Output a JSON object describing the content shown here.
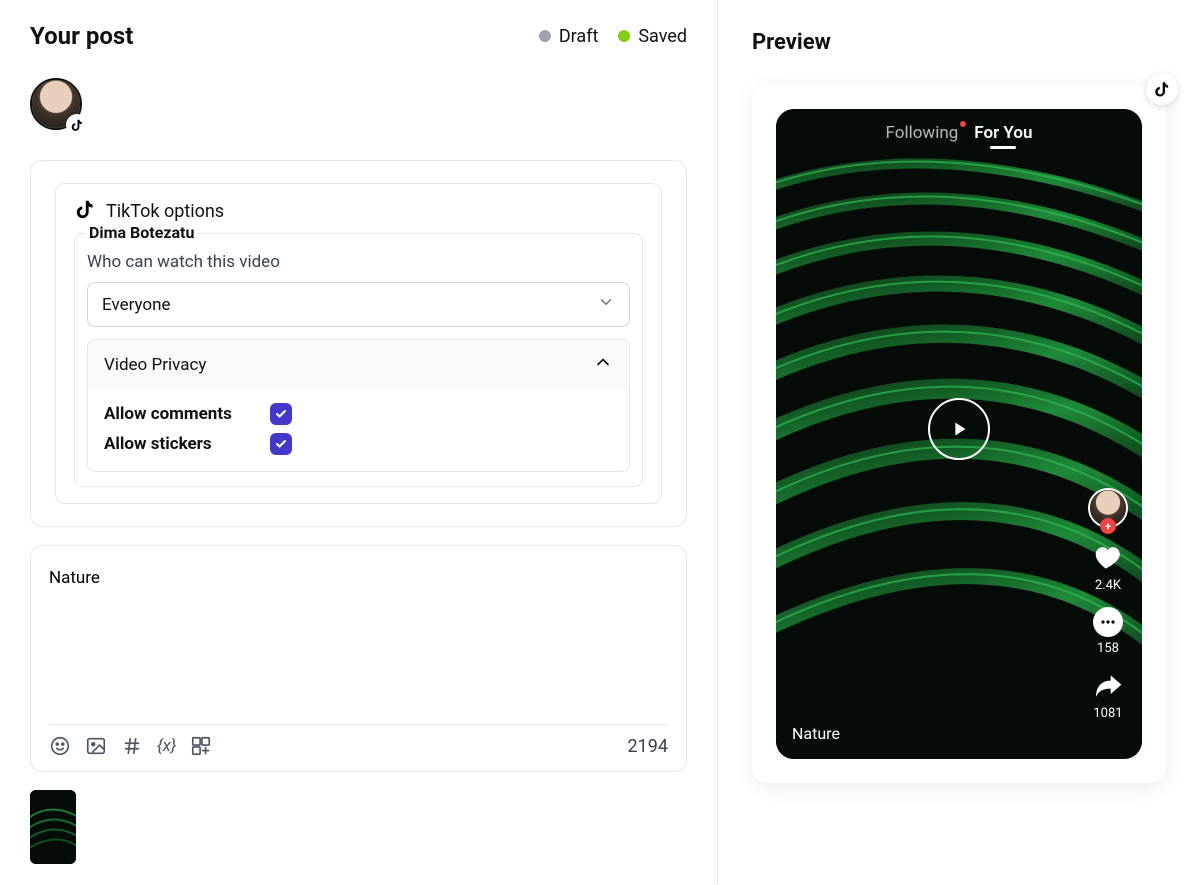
{
  "header": {
    "title": "Your post",
    "status": {
      "draft_label": "Draft",
      "saved_label": "Saved"
    }
  },
  "options": {
    "section_label": "TikTok options",
    "account_name": "Dima Botezatu",
    "watch_label": "Who can watch this video",
    "watch_value": "Everyone",
    "privacy_section": "Video Privacy",
    "allow_comments_label": "Allow comments",
    "allow_stickers_label": "Allow stickers"
  },
  "composer": {
    "text": "Nature",
    "char_count": "2194",
    "variable_glyph": "{x}"
  },
  "preview": {
    "title": "Preview",
    "tabs": {
      "following": "Following",
      "for_you": "For You"
    },
    "likes": "2.4K",
    "comments": "158",
    "shares": "1081",
    "caption": "Nature"
  },
  "colors": {
    "checkbox": "#4338ca",
    "saved_dot": "#84cc16",
    "draft_dot": "#9ca3af"
  }
}
